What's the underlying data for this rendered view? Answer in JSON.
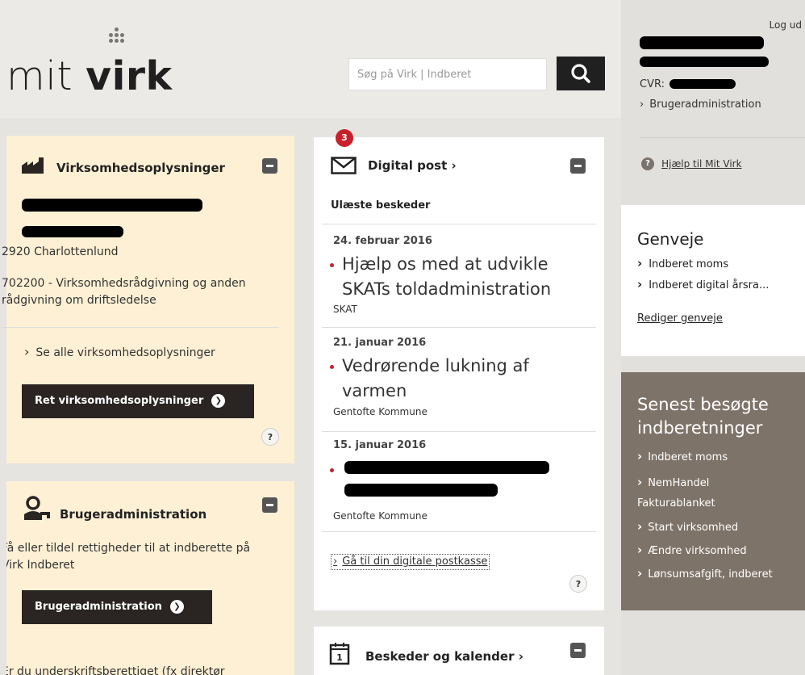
{
  "header": {
    "logo_text_thin": "mit",
    "logo_text_bold": "virk",
    "search": {
      "placeholder": "Søg på Virk | Indberet"
    },
    "search_icon": "search-icon"
  },
  "company_panel": {
    "icon": "factory-icon",
    "title": "Virksomhedsoplysninger",
    "postal": "2920 Charlottenlund",
    "industry": "702200 - Virksomhedsrådgivning og anden rådgivning om driftsledelse",
    "see_all_link": "Se alle virksomhedsoplysninger",
    "edit_button": "Ret virksomhedsoplysninger",
    "help": "?"
  },
  "user_admin_panel": {
    "icon": "user-key-icon",
    "title": "Brugeradministration",
    "description": "Få eller tildel rettigheder til at indberette på Virk Indberet",
    "button": "Brugeradministration",
    "footer_text": "Er du underskriftsberettiget (fx direktør"
  },
  "digital_post": {
    "badge": "3",
    "icon": "envelope-icon",
    "title": "Digital post ›",
    "subtitle": "Ulæste beskeder",
    "messages": [
      {
        "date": "24. februar 2016",
        "title": "Hjælp os med at udvikle SKATs toldadministration",
        "sender": "SKAT"
      },
      {
        "date": "21. januar 2016",
        "title": "Vedrørende lukning af varmen",
        "sender": "Gentofte Kommune"
      },
      {
        "date": "15. januar 2016",
        "title": "",
        "sender": "Gentofte Kommune"
      }
    ],
    "mailbox_link": "Gå til din digitale postkasse",
    "help": "?"
  },
  "calendar_panel": {
    "icon": "calendar-icon",
    "title": "Beskeder og kalender ›"
  },
  "right_column": {
    "logout": "Log ud",
    "cvr_label": "CVR:",
    "user_admin_link": "Brugeradministration",
    "help_link": "Hjælp til Mit Virk",
    "shortcuts": {
      "title": "Genveje",
      "items": [
        "Indberet moms",
        "Indberet digital årsra..."
      ],
      "edit_link": "Rediger genveje"
    },
    "recent": {
      "title": "Senest besøgte indberetninger",
      "items": [
        "Indberet moms",
        "NemHandel Fakturablanket",
        "Start virksomhed",
        "Ændre virksomhed",
        "Lønsumsafgift, indberet"
      ]
    }
  }
}
